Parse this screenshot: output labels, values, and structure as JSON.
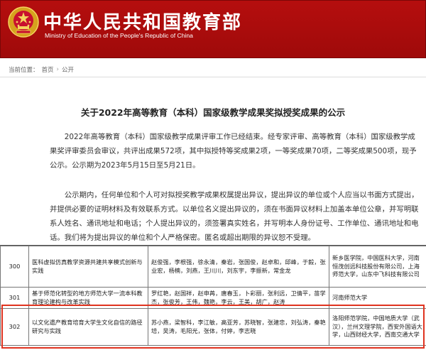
{
  "header": {
    "site_name": "中华人民共和国教育部",
    "site_name_en": "Ministry of Education of the People's Republic of China",
    "emblem_icon": "national-emblem-icon"
  },
  "breadcrumb": {
    "prefix": "当前位置：",
    "home": "首页",
    "separator": "›",
    "current": "公开"
  },
  "article": {
    "title": "关于2022年高等教育（本科）国家级教学成果奖拟授奖成果的公示",
    "paragraph1": "2022年高等教育（本科）国家级教学成果评审工作已经结束。经专家评审、高等教育（本科）国家级教学成果奖评审委员会审议，共评出成果572项，其中拟授特等奖成果2项，一等奖成果70项，二等奖成果500项，现予公示。公示期为2023年5月15日至5月21日。",
    "paragraph2": "公示期内，任何单位和个人可对拟授奖教学成果权属提出异议，提出异议的单位或个人应当以书面方式提出，并提供必要的证明材料及有效联系方式。以单位名义提出异议的，须在书面异议材料上加盖本单位公章，并写明联系人姓名、通讯地址和电话；个人提出异议的，须签署真实姓名，并写明本人身份证号、工作单位、通讯地址和电话。我们将为提出异议的单位和个人严格保密。匿名或超出期限的异议恕不受理。"
  },
  "table": {
    "rows": [
      {
        "num": "300",
        "name": "医科虚拟仿真教学资源共建共享模式创新与实践",
        "people": "赵俊强，李根强，徐永清，秦岩，张国俊，赵卓和，邱峰，于毅，张业宏，杨楠，刘燕，王川川，刘东宇，李振新，常金龙",
        "units": "新乡医学院，中国医科大学，河南恒茂创远科技股份有限公司，上海师范大学，山东中飞科技有限公司"
      },
      {
        "num": "301",
        "name": "基于师范化转型的地方师范大学一流本科教育理论建构与改革实践",
        "people": "罗红艳，赵国祥，赵申苒，唐春玉，卜彩丽，张利远，卫倩平，苗学杰，张俊芳，王伟，魏艳，李云，王美，胡广，赵涛",
        "units": "河南师范大学"
      },
      {
        "num": "302",
        "name": "以文化遗产教育培育大学生文化自信的路径研究与实践",
        "people": "苏小燕，梁智科，李江敏，高亚芳，苏晓智，张建忠，刘弘涛，秦艳培，吴涛，毛阳光，张体，付婷，李志晓",
        "units": "洛阳师范学院，中国地质大学（武汉），兰州文理学院，西安外国语大学，山西财经大学，西南交通大学"
      }
    ]
  }
}
